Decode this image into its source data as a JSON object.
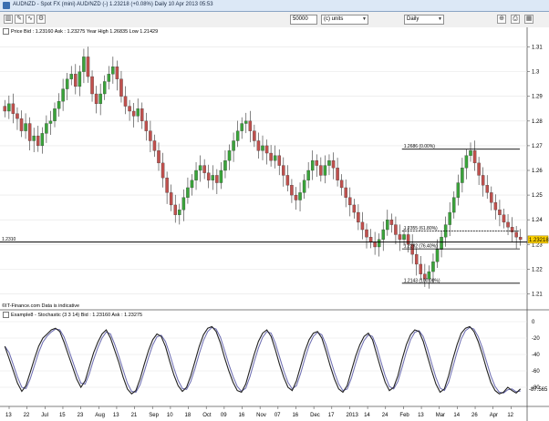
{
  "window": {
    "title": "AUDNZD - Spot FX (mini) AUD/NZD (-)   1.23218 (+0.08%)   Daily  10 Apr 2013 05:53"
  },
  "toolbar": {
    "quantity_value": "50000",
    "units_value": "(c) units",
    "interval_value": "Daily",
    "icons": [
      "chart-type-icon",
      "draw-tools-icon",
      "indicator-icon",
      "settings-icon",
      "zoom-icon",
      "print-icon"
    ]
  },
  "price_panel": {
    "header": "Price  Bid : 1.23160  Ask : 1.23275  Year High 1.26835  Low 1.21429",
    "watermark": "©IT-Finance.com  Data is indicative",
    "last_price_tag": "1.23218",
    "hline_label": "1.2310",
    "y_ticks": [
      "1.31",
      "1.3",
      "1.29",
      "1.28",
      "1.27",
      "1.26",
      "1.25",
      "1.24",
      "1.23",
      "1.22",
      "1.21"
    ]
  },
  "fibonacci": [
    {
      "label": "1.2686 (0.00%)"
    },
    {
      "label": "1.2355 (61.80%)"
    },
    {
      "label": "1.2282 (76.40%)"
    },
    {
      "label": "1.2143 (100.00%)"
    }
  ],
  "stochastic_panel": {
    "header": "Example8 - Stochastic (3 3 14)  Bid : 1.23160  Ask : 1.23275",
    "y_ticks": [
      "-80",
      "-60",
      "-40",
      "-20",
      "0",
      "-87.565"
    ]
  },
  "x_axis": {
    "ticks": [
      "13",
      "22",
      "Jul",
      "15",
      "23",
      "Aug",
      "13",
      "21",
      "Sep",
      "10",
      "18",
      "Oct",
      "09",
      "16",
      "Nov",
      "07",
      "16",
      "Dec",
      "17",
      "2013",
      "14",
      "24",
      "Feb",
      "13",
      "Mar",
      "14",
      "26",
      "Apr",
      "12"
    ]
  },
  "chart_data": {
    "type": "candlestick",
    "symbol": "AUDNZD",
    "interval": "Daily",
    "ylim": [
      1.205,
      1.315
    ],
    "close": [
      1.284,
      1.287,
      1.283,
      1.281,
      1.276,
      1.279,
      1.272,
      1.274,
      1.27,
      1.275,
      1.279,
      1.28,
      1.285,
      1.288,
      1.293,
      1.297,
      1.299,
      1.294,
      1.3,
      1.306,
      1.298,
      1.291,
      1.287,
      1.291,
      1.296,
      1.299,
      1.302,
      1.297,
      1.29,
      1.286,
      1.284,
      1.282,
      1.285,
      1.28,
      1.276,
      1.272,
      1.268,
      1.263,
      1.257,
      1.251,
      1.246,
      1.242,
      1.244,
      1.249,
      1.253,
      1.256,
      1.26,
      1.262,
      1.259,
      1.256,
      1.258,
      1.255,
      1.26,
      1.264,
      1.268,
      1.272,
      1.276,
      1.279,
      1.28,
      1.276,
      1.272,
      1.268,
      1.27,
      1.267,
      1.264,
      1.266,
      1.262,
      1.258,
      1.254,
      1.25,
      1.248,
      1.251,
      1.256,
      1.26,
      1.264,
      1.262,
      1.258,
      1.262,
      1.264,
      1.261,
      1.256,
      1.253,
      1.249,
      1.246,
      1.243,
      1.239,
      1.236,
      1.233,
      1.231,
      1.229,
      1.232,
      1.236,
      1.24,
      1.238,
      1.234,
      1.232,
      1.234,
      1.23,
      1.226,
      1.222,
      1.218,
      1.216,
      1.219,
      1.223,
      1.228,
      1.233,
      1.238,
      1.243,
      1.249,
      1.255,
      1.261,
      1.266,
      1.268,
      1.263,
      1.258,
      1.254,
      1.251,
      1.247,
      1.244,
      1.242,
      1.239,
      1.237,
      1.235,
      1.233,
      1.232
    ],
    "fib_levels": [
      1.2686,
      1.2355,
      1.2282,
      1.2143
    ],
    "hline": 1.231,
    "stochastic": [
      -30,
      -45,
      -60,
      -75,
      -85,
      -78,
      -62,
      -45,
      -30,
      -20,
      -15,
      -10,
      -8,
      -12,
      -25,
      -40,
      -55,
      -70,
      -80,
      -72,
      -55,
      -38,
      -25,
      -15,
      -10,
      -20,
      -35,
      -50,
      -68,
      -82,
      -88,
      -84,
      -70,
      -52,
      -35,
      -22,
      -15,
      -18,
      -30,
      -48,
      -65,
      -78,
      -85,
      -80,
      -66,
      -48,
      -30,
      -16,
      -8,
      -6,
      -12,
      -26,
      -44,
      -60,
      -74,
      -84,
      -86,
      -76,
      -58,
      -40,
      -24,
      -14,
      -10,
      -18,
      -34,
      -52,
      -68,
      -80,
      -84,
      -72,
      -54,
      -36,
      -22,
      -14,
      -12,
      -20,
      -36,
      -54,
      -70,
      -82,
      -86,
      -78,
      -60,
      -42,
      -28,
      -18,
      -14,
      -22,
      -40,
      -58,
      -74,
      -84,
      -80,
      -66,
      -46,
      -28,
      -16,
      -10,
      -12,
      -24,
      -42,
      -60,
      -76,
      -86,
      -82,
      -66,
      -46,
      -28,
      -14,
      -8,
      -6,
      -12,
      -24,
      -40,
      -58,
      -74,
      -84,
      -88,
      -86,
      -80,
      -84,
      -87,
      -82
    ]
  }
}
